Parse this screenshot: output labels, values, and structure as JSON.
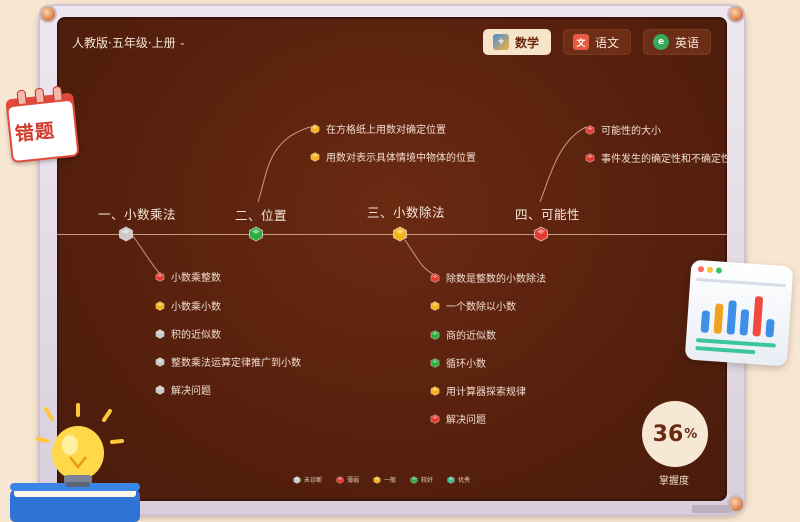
{
  "header": {
    "edition": "人教版·五年级·上册",
    "tabs": [
      {
        "label": "数学",
        "icon": "math-icon",
        "active": true
      },
      {
        "label": "语文",
        "icon": "chinese-icon",
        "active": false
      },
      {
        "label": "英语",
        "icon": "english-icon",
        "active": false
      }
    ]
  },
  "sticker": {
    "label": "错题"
  },
  "units": [
    {
      "title": "一、小数乘法",
      "status": "unassessed",
      "items": [
        {
          "label": "小数乘整数",
          "status": "weak"
        },
        {
          "label": "小数乘小数",
          "status": "average"
        },
        {
          "label": "积的近似数",
          "status": "unassessed"
        },
        {
          "label": "整数乘法运算定律推广到小数",
          "status": "unassessed"
        },
        {
          "label": "解决问题",
          "status": "unassessed"
        }
      ]
    },
    {
      "title": "二、位置",
      "status": "good",
      "items": [
        {
          "label": "在方格纸上用数对确定位置",
          "status": "average"
        },
        {
          "label": "用数对表示具体情境中物体的位置",
          "status": "average"
        }
      ]
    },
    {
      "title": "三、小数除法",
      "status": "average",
      "items": [
        {
          "label": "除数是整数的小数除法",
          "status": "weak"
        },
        {
          "label": "一个数除以小数",
          "status": "average"
        },
        {
          "label": "商的近似数",
          "status": "good"
        },
        {
          "label": "循环小数",
          "status": "good"
        },
        {
          "label": "用计算器探索规律",
          "status": "average"
        },
        {
          "label": "解决问题",
          "status": "weak"
        }
      ]
    },
    {
      "title": "四、可能性",
      "status": "weak",
      "items": [
        {
          "label": "可能性的大小",
          "status": "weak"
        },
        {
          "label": "事件发生的确定性和不确定性",
          "status": "weak"
        }
      ]
    }
  ],
  "legend": [
    {
      "label": "未诊断",
      "status": "unassessed"
    },
    {
      "label": "薄弱",
      "status": "weak"
    },
    {
      "label": "一般",
      "status": "average"
    },
    {
      "label": "较好",
      "status": "good"
    },
    {
      "label": "优秀",
      "status": "excellent"
    }
  ],
  "mastery": {
    "value": "36",
    "unit": "%",
    "label": "掌握度"
  },
  "colors": {
    "unassessed": "#c9c9cc",
    "weak": "#e43a2f",
    "average": "#f5b31b",
    "good": "#2fae3f",
    "excellent": "#3fc08a",
    "board": "#56200d",
    "accent": "#f6e4cb"
  }
}
